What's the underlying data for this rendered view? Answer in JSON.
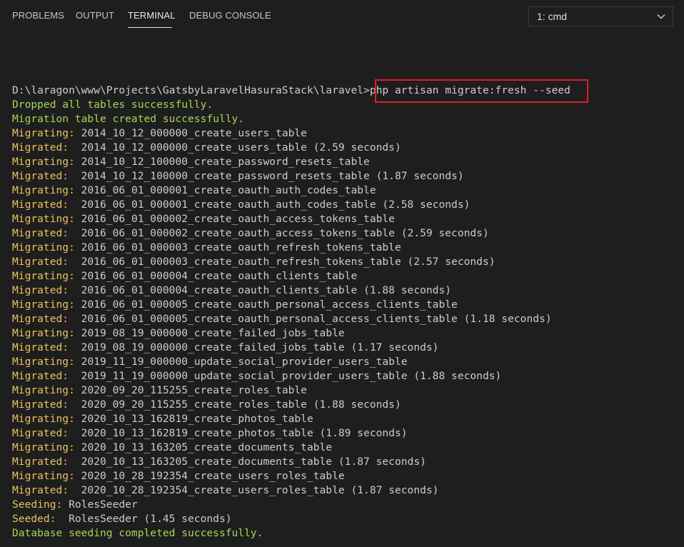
{
  "tabs": [
    {
      "label": "PROBLEMS",
      "active": false
    },
    {
      "label": "OUTPUT",
      "active": false
    },
    {
      "label": "TERMINAL",
      "active": true
    },
    {
      "label": "DEBUG CONSOLE",
      "active": false
    }
  ],
  "terminal_select": {
    "value": "1: cmd",
    "icon": "chevron-down-icon"
  },
  "colors": {
    "background": "#1e1e1e",
    "success_green": "#a6d55a",
    "label_yellow": "#e8c35e",
    "default_text": "#cccccc",
    "highlight_border": "#e41c23"
  },
  "terminal": {
    "prompt": "D:\\laragon\\www\\Projects\\GatsbyLaravelHasuraStack\\laravel>",
    "command": "php artisan migrate:fresh --seed",
    "lines": [
      {
        "label": "",
        "text": "Dropped all tables successfully.",
        "kind": "success"
      },
      {
        "label": "",
        "text": "Migration table created successfully.",
        "kind": "success"
      },
      {
        "label": "Migrating:",
        "text": " 2014_10_12_000000_create_users_table",
        "kind": "status"
      },
      {
        "label": "Migrated:",
        "text": "  2014_10_12_000000_create_users_table (2.59 seconds)",
        "kind": "status"
      },
      {
        "label": "Migrating:",
        "text": " 2014_10_12_100000_create_password_resets_table",
        "kind": "status"
      },
      {
        "label": "Migrated:",
        "text": "  2014_10_12_100000_create_password_resets_table (1.87 seconds)",
        "kind": "status"
      },
      {
        "label": "Migrating:",
        "text": " 2016_06_01_000001_create_oauth_auth_codes_table",
        "kind": "status"
      },
      {
        "label": "Migrated:",
        "text": "  2016_06_01_000001_create_oauth_auth_codes_table (2.58 seconds)",
        "kind": "status"
      },
      {
        "label": "Migrating:",
        "text": " 2016_06_01_000002_create_oauth_access_tokens_table",
        "kind": "status"
      },
      {
        "label": "Migrated:",
        "text": "  2016_06_01_000002_create_oauth_access_tokens_table (2.59 seconds)",
        "kind": "status"
      },
      {
        "label": "Migrating:",
        "text": " 2016_06_01_000003_create_oauth_refresh_tokens_table",
        "kind": "status"
      },
      {
        "label": "Migrated:",
        "text": "  2016_06_01_000003_create_oauth_refresh_tokens_table (2.57 seconds)",
        "kind": "status"
      },
      {
        "label": "Migrating:",
        "text": " 2016_06_01_000004_create_oauth_clients_table",
        "kind": "status"
      },
      {
        "label": "Migrated:",
        "text": "  2016_06_01_000004_create_oauth_clients_table (1.88 seconds)",
        "kind": "status"
      },
      {
        "label": "Migrating:",
        "text": " 2016_06_01_000005_create_oauth_personal_access_clients_table",
        "kind": "status"
      },
      {
        "label": "Migrated:",
        "text": "  2016_06_01_000005_create_oauth_personal_access_clients_table (1.18 seconds)",
        "kind": "status"
      },
      {
        "label": "Migrating:",
        "text": " 2019_08_19_000000_create_failed_jobs_table",
        "kind": "status"
      },
      {
        "label": "Migrated:",
        "text": "  2019_08_19_000000_create_failed_jobs_table (1.17 seconds)",
        "kind": "status"
      },
      {
        "label": "Migrating:",
        "text": " 2019_11_19_000000_update_social_provider_users_table",
        "kind": "status"
      },
      {
        "label": "Migrated:",
        "text": "  2019_11_19_000000_update_social_provider_users_table (1.88 seconds)",
        "kind": "status"
      },
      {
        "label": "Migrating:",
        "text": " 2020_09_20_115255_create_roles_table",
        "kind": "status"
      },
      {
        "label": "Migrated:",
        "text": "  2020_09_20_115255_create_roles_table (1.88 seconds)",
        "kind": "status"
      },
      {
        "label": "Migrating:",
        "text": " 2020_10_13_162819_create_photos_table",
        "kind": "status"
      },
      {
        "label": "Migrated:",
        "text": "  2020_10_13_162819_create_photos_table (1.89 seconds)",
        "kind": "status"
      },
      {
        "label": "Migrating:",
        "text": " 2020_10_13_163205_create_documents_table",
        "kind": "status"
      },
      {
        "label": "Migrated:",
        "text": "  2020_10_13_163205_create_documents_table (1.87 seconds)",
        "kind": "status"
      },
      {
        "label": "Migrating:",
        "text": " 2020_10_28_192354_create_users_roles_table",
        "kind": "status"
      },
      {
        "label": "Migrated:",
        "text": "  2020_10_28_192354_create_users_roles_table (1.87 seconds)",
        "kind": "status"
      },
      {
        "label": "Seeding:",
        "text": " RolesSeeder",
        "kind": "status"
      },
      {
        "label": "Seeded:",
        "text": "  RolesSeeder (1.45 seconds)",
        "kind": "status"
      },
      {
        "label": "",
        "text": "Database seeding completed successfully.",
        "kind": "success"
      }
    ]
  }
}
